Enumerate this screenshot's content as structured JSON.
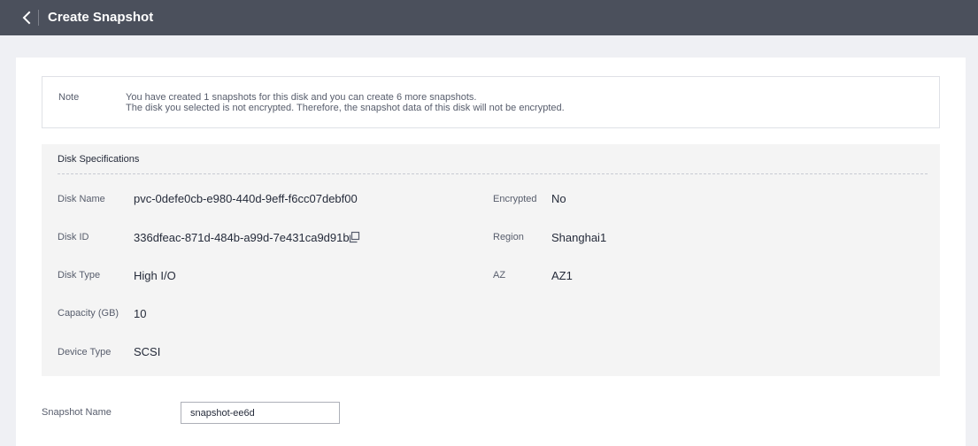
{
  "header": {
    "title": "Create Snapshot",
    "back_icon": "chevron-left-icon"
  },
  "note": {
    "label": "Note",
    "lines": [
      "You have created 1 snapshots for this disk and you can create 6 more snapshots.",
      "The disk you selected is not encrypted. Therefore, the snapshot data of this disk will not be encrypted."
    ]
  },
  "disk_specs": {
    "title": "Disk Specifications",
    "left": [
      {
        "label": "Disk Name",
        "value": "pvc-0defe0cb-e980-440d-9eff-f6cc07debf00"
      },
      {
        "label": "Disk ID",
        "value": "336dfeac-871d-484b-a99d-7e431ca9d91b",
        "icon": "copy-icon"
      },
      {
        "label": "Disk Type",
        "value": "High I/O"
      },
      {
        "label": "Capacity (GB)",
        "value": "10"
      },
      {
        "label": "Device Type",
        "value": "SCSI"
      }
    ],
    "right": [
      {
        "label": "Encrypted",
        "value": "No"
      },
      {
        "label": "Region",
        "value": "Shanghai1"
      },
      {
        "label": "AZ",
        "value": "AZ1"
      }
    ]
  },
  "snapshot_name": {
    "label": "Snapshot Name",
    "value": "snapshot-ee6d"
  },
  "colors": {
    "topbar_bg": "#4b505c",
    "page_bg": "#eff0f4",
    "panel_bg": "#f4f4f4"
  }
}
